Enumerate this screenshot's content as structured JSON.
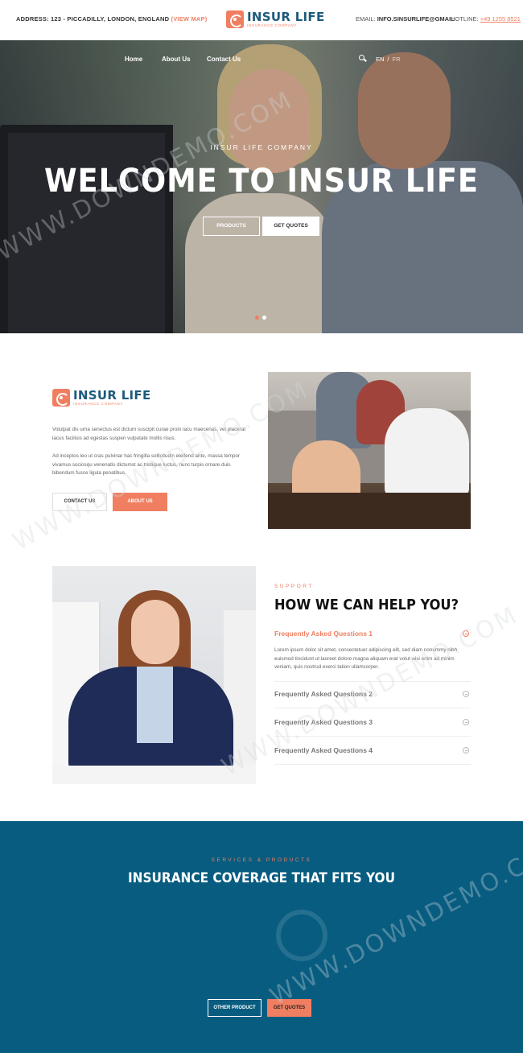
{
  "topbar": {
    "address_label": "ADDRESS: 123 - PICCADILLY, LONDON, ENGLAND",
    "view_map": "(VIEW MAP)",
    "email_label": "EMAIL:",
    "email_value": "INFO.SINSURLIFE@GMAIL",
    "hotline_label": "HOTLINE:",
    "hotline_value": "+49 1255 8521"
  },
  "logo": {
    "name": "INSUR LIFE",
    "tagline": "INSURANCE COMPANY"
  },
  "nav": {
    "items": [
      "Home",
      "About Us",
      "Contact Us"
    ]
  },
  "lang": {
    "en": "EN",
    "separator": "/",
    "fr": "FR"
  },
  "hero": {
    "kicker": "INSUR LIFE COMPANY",
    "title": "WELCOME TO INSUR LIFE",
    "btn_products": "PRODUCTS",
    "btn_quotes": "GET QUOTES",
    "active_slide": 1,
    "slide_count": 2
  },
  "about": {
    "p1": "Volutpat dis urna senectus est dictum suscipit curae proin iacu maecenas, vel placerat lacus facilisis ad egestas suspen vulputate mollis risus.",
    "p2": "Ad inceptos leo ut cras pulvinar hac fringilla sollicitudin eleifend ante, massa tempor vivamus sociosqu venenatis dictumst ac tristique luctus, nunc turpis ornare duis bibendum fusce ligula penatibus.",
    "btn_contact": "CONTACT US",
    "btn_about": "ABOUT US"
  },
  "help": {
    "kicker": "SUPPORT",
    "heading": "HOW WE CAN HELP YOU?",
    "faqs": [
      {
        "q": "Frequently Asked Questions 1",
        "a": "Lorem ipsum dolor sit amet, consectetuer adipiscing elit, sed diam nonummy nibh euismod tincidunt ut laoreet dolore magna aliquam erat volut wisi enim ad minim veniam, quis nostrud exerci tation ullamcorper."
      },
      {
        "q": "Frequently Asked Questions 2"
      },
      {
        "q": "Frequently Asked Questions 3"
      },
      {
        "q": "Frequently Asked Questions 4"
      }
    ]
  },
  "services": {
    "kicker": "SERVICES & PRODUCTS",
    "title": "INSURANCE COVERAGE THAT FITS YOU",
    "btn_other": "OTHER PRODUCT",
    "btn_quotes": "GET QUOTES"
  },
  "watermark": "WWW.DOWNDEMO.COM",
  "colors": {
    "accent": "#f07f62",
    "brand": "#1d5a7c",
    "services_bg": "#075c80"
  }
}
